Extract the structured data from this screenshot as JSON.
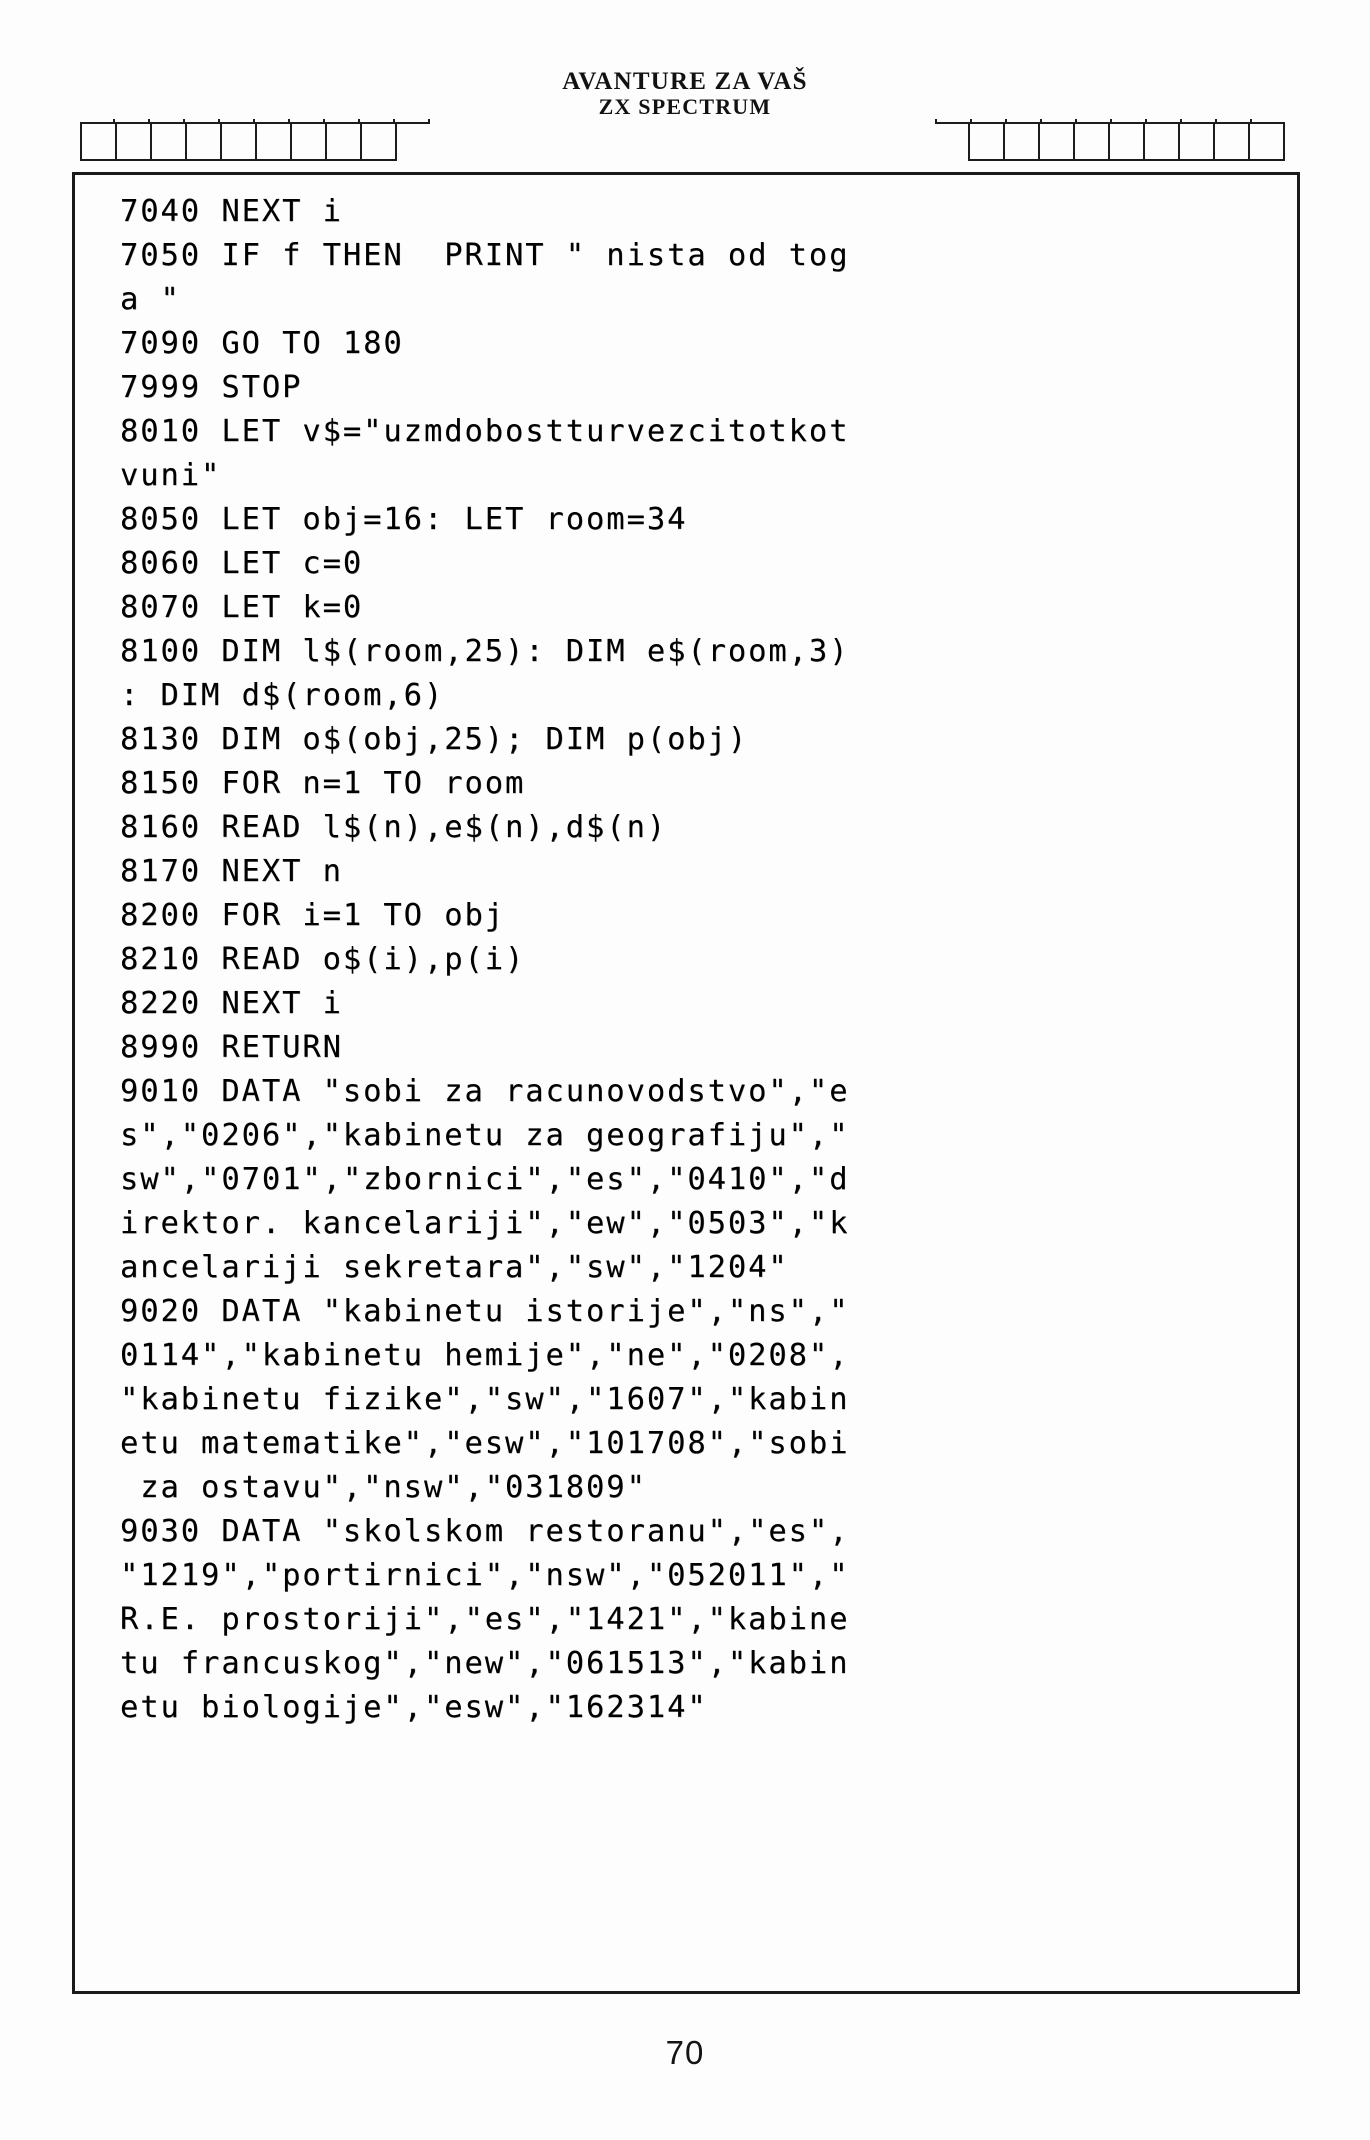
{
  "header": {
    "title_line1": "AVANTURE ZA VAŠ",
    "title_line2": "ZX SPECTRUM",
    "decoration": {
      "left_top_cells": 9,
      "left_bottom_cells": 9,
      "right_top_cells": 9,
      "right_bottom_cells": 9
    }
  },
  "listing": {
    "language": "ZX Spectrum BASIC",
    "lines": [
      "7040 NEXT i",
      "7050 IF f THEN  PRINT \" nista od tog",
      "a \"",
      "7090 GO TO 180",
      "7999 STOP",
      "8010 LET v$=\"uzmdobostturvezcitotkot",
      "vuni\"",
      "8050 LET obj=16: LET room=34",
      "8060 LET c=0",
      "8070 LET k=0",
      "8100 DIM l$(room,25): DIM e$(room,3)",
      ": DIM d$(room,6)",
      "8130 DIM o$(obj,25); DIM p(obj)",
      "8150 FOR n=1 TO room",
      "8160 READ l$(n),e$(n),d$(n)",
      "8170 NEXT n",
      "8200 FOR i=1 TO obj",
      "8210 READ o$(i),p(i)",
      "8220 NEXT i",
      "8990 RETURN",
      "9010 DATA \"sobi za racunovodstvo\",\"e",
      "s\",\"0206\",\"kabinetu za geografiju\",\"",
      "sw\",\"0701\",\"zbornici\",\"es\",\"0410\",\"d",
      "irektor. kancelariji\",\"ew\",\"0503\",\"k",
      "ancelariji sekretara\",\"sw\",\"1204\"",
      "9020 DATA \"kabinetu istorije\",\"ns\",\"",
      "0114\",\"kabinetu hemije\",\"ne\",\"0208\",",
      "\"kabinetu fizike\",\"sw\",\"1607\",\"kabin",
      "etu matematike\",\"esw\",\"101708\",\"sobi",
      " za ostavu\",\"nsw\",\"031809\"",
      "9030 DATA \"skolskom restoranu\",\"es\",",
      "\"1219\",\"portirnici\",\"nsw\",\"052011\",\"",
      "R.E. prostoriji\",\"es\",\"1421\",\"kabine",
      "tu francuskog\",\"new\",\"061513\",\"kabin",
      "etu biologije\",\"esw\",\"162314\""
    ]
  },
  "footer": {
    "page_number": "70"
  },
  "colors": {
    "ink": "#0d0d0d",
    "rule": "#1a1a1a",
    "paper": "#fdfdfd"
  }
}
